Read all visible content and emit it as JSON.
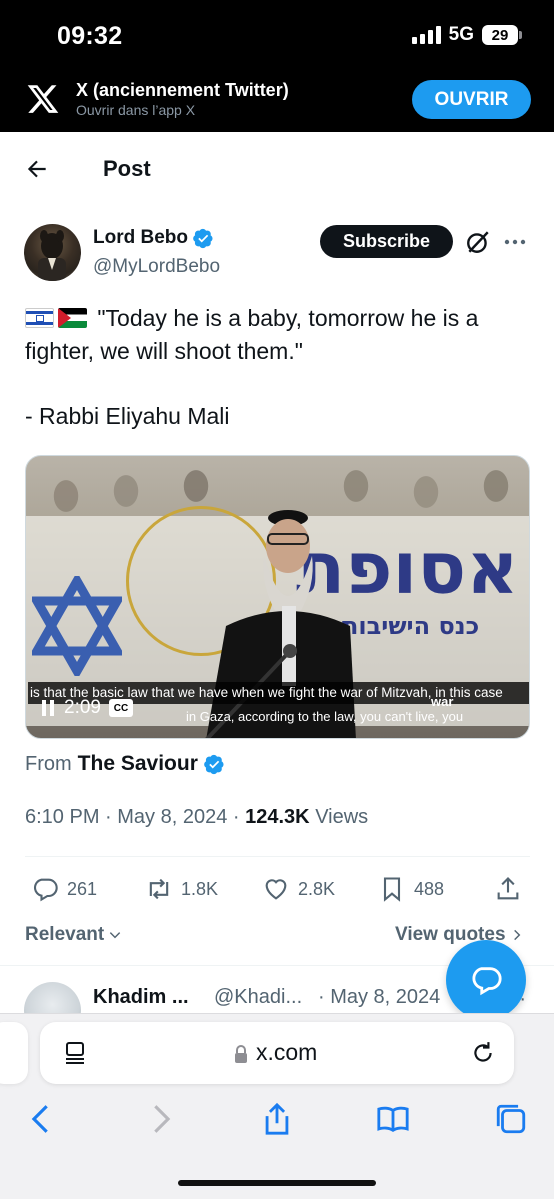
{
  "status_bar": {
    "time": "09:32",
    "network": "5G",
    "battery": "29"
  },
  "app_banner": {
    "title": "X (anciennement Twitter)",
    "subtitle": "Ouvrir dans l’app X",
    "open_label": "OUVRIR"
  },
  "header": {
    "title": "Post"
  },
  "author": {
    "name": "Lord Bebo",
    "handle": "@MyLordBebo",
    "subscribe_label": "Subscribe"
  },
  "tweet": {
    "text": "\"Today he is a baby, tomorrow he is a fighter, we will shoot them.\"",
    "attribution": "- Rabbi Eliyahu Mali"
  },
  "video": {
    "time": "2:09",
    "cc_label": "CC",
    "subtitle_line1": "is that the basic law that we have when we fight the war of Mitzvah, in this case",
    "subtitle_line2": "in Gaza, according to the law, you can't live, you",
    "subtitle_word": "war",
    "hebrew_large": "אסופת",
    "hebrew_small": "כנס הישיבות"
  },
  "source": {
    "from_label": "From",
    "name": "The Saviour"
  },
  "meta": {
    "time": "6:10 PM",
    "date": "May 8, 2024",
    "views_count": "124.3K",
    "views_label": "Views"
  },
  "actions": {
    "replies": "261",
    "reposts": "1.8K",
    "likes": "2.8K",
    "bookmarks": "488"
  },
  "sort": {
    "relevant_label": "Relevant",
    "view_quotes_label": "View quotes"
  },
  "reply_preview": {
    "name": "Khadim ...",
    "handle": "@Khadi...",
    "date": "· May 8, 2024"
  },
  "safari": {
    "url": "x.com"
  },
  "colors": {
    "accent": "#1d9bf0",
    "text": "#0f1419",
    "secondary": "#536471"
  }
}
